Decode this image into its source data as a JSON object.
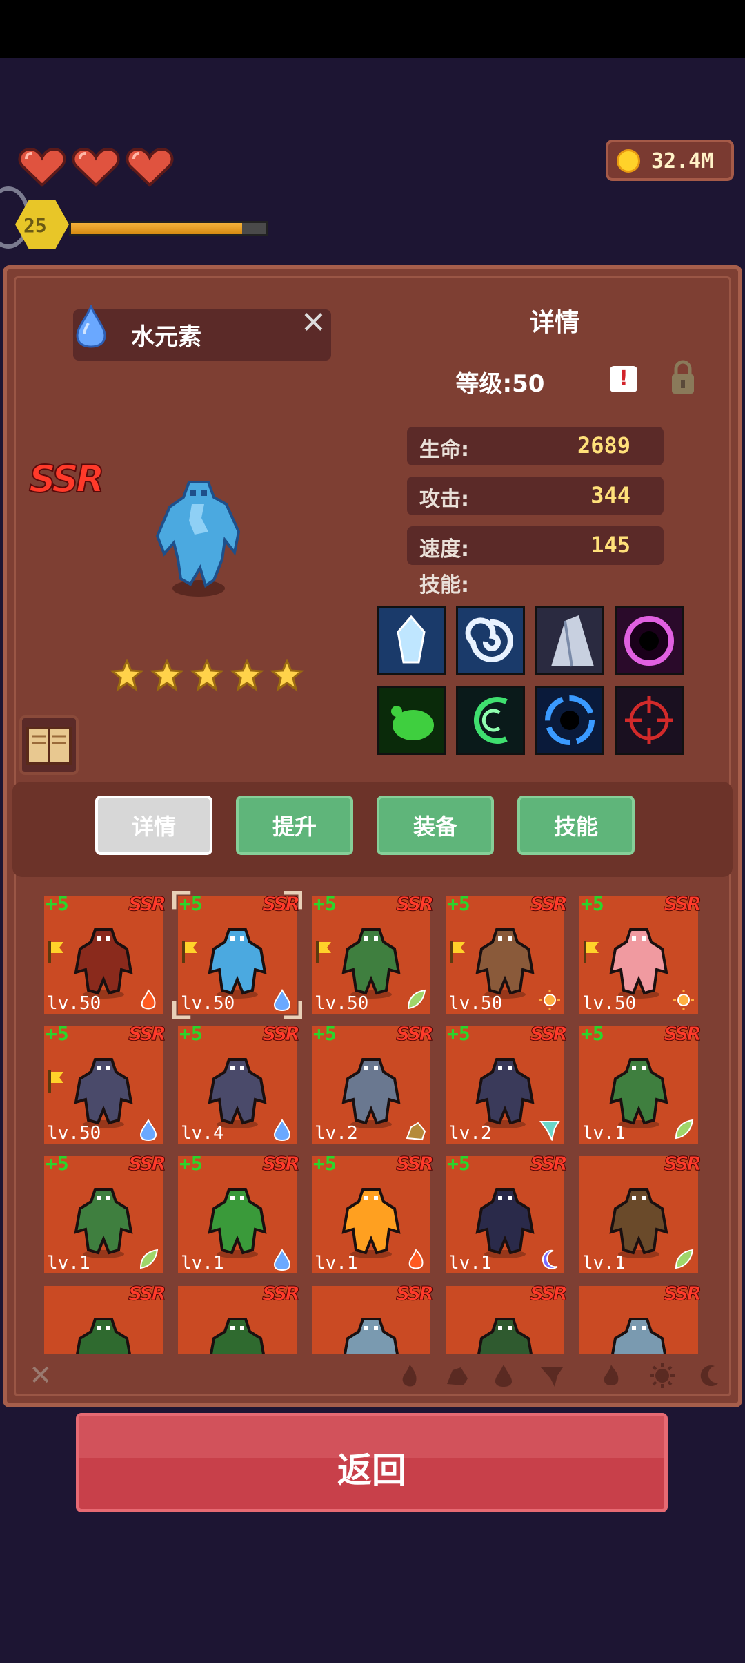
{
  "hud": {
    "hearts": 3,
    "coins": "32.4M",
    "player_level": "25",
    "xp_fraction": 0.88
  },
  "unit": {
    "name": "水元素",
    "rarity": "SSR",
    "stars": 5,
    "panel_title": "详情",
    "level_text": "等级:50",
    "alert_mark": "!"
  },
  "stats": [
    {
      "label": "生命:",
      "value": "2689"
    },
    {
      "label": "攻击:",
      "value": "344"
    },
    {
      "label": "速度:",
      "value": "145"
    }
  ],
  "skills_label": "技能:",
  "skills": [
    "ice-crystal-skill-icon",
    "whirlwind-skill-icon",
    "frost-shard-skill-icon",
    "void-orb-skill-icon",
    "poison-slime-skill-icon",
    "green-vortex-skill-icon",
    "blue-vortex-skill-icon",
    "target-reticle-skill-icon"
  ],
  "tabs": [
    {
      "label": "详情",
      "active": true
    },
    {
      "label": "提升",
      "active": false
    },
    {
      "label": "装备",
      "active": false
    },
    {
      "label": "技能",
      "active": false
    }
  ],
  "roster": [
    {
      "plus": "+5",
      "rarity": "SSR",
      "level": "lv.50",
      "flag": true,
      "creature": "fire-warlord",
      "element": "fire",
      "color": "#8a2a1c"
    },
    {
      "plus": "+5",
      "rarity": "SSR",
      "level": "lv.50",
      "flag": true,
      "creature": "water-elemental",
      "element": "water",
      "color": "#4ba9e0",
      "selected": true
    },
    {
      "plus": "+5",
      "rarity": "SSR",
      "level": "lv.50",
      "flag": true,
      "creature": "orc-knight",
      "element": "nature",
      "color": "#3f7f3f"
    },
    {
      "plus": "+5",
      "rarity": "SSR",
      "level": "lv.50",
      "flag": true,
      "creature": "centaur-spear",
      "element": "light",
      "color": "#8a5a3a"
    },
    {
      "plus": "+5",
      "rarity": "SSR",
      "level": "lv.50",
      "flag": true,
      "creature": "fairy",
      "element": "light",
      "color": "#f09aa0"
    },
    {
      "plus": "+5",
      "rarity": "SSR",
      "level": "lv.50",
      "flag": true,
      "creature": "skeleton-rider",
      "element": "water",
      "color": "#4a4a6a"
    },
    {
      "plus": "+5",
      "rarity": "SSR",
      "level": "lv.4",
      "flag": false,
      "creature": "skeleton-rider",
      "element": "water",
      "color": "#4a4a6a"
    },
    {
      "plus": "+5",
      "rarity": "SSR",
      "level": "lv.2",
      "flag": false,
      "creature": "stone-golem",
      "element": "earth",
      "color": "#6a7890"
    },
    {
      "plus": "+5",
      "rarity": "SSR",
      "level": "lv.2",
      "flag": false,
      "creature": "shadow-hound",
      "element": "wind",
      "color": "#3a3a5a"
    },
    {
      "plus": "+5",
      "rarity": "SSR",
      "level": "lv.1",
      "flag": false,
      "creature": "orc-knight",
      "element": "nature",
      "color": "#3f7f3f"
    },
    {
      "plus": "+5",
      "rarity": "SSR",
      "level": "lv.1",
      "flag": false,
      "creature": "orc-knight",
      "element": "nature",
      "color": "#3f7f3f"
    },
    {
      "plus": "+5",
      "rarity": "SSR",
      "level": "lv.1",
      "flag": false,
      "creature": "slime-golem",
      "element": "water",
      "color": "#3a9a3a"
    },
    {
      "plus": "+5",
      "rarity": "SSR",
      "level": "lv.1",
      "flag": false,
      "creature": "fire-spirit",
      "element": "fire",
      "color": "#ffa020"
    },
    {
      "plus": "+5",
      "rarity": "SSR",
      "level": "lv.1",
      "flag": false,
      "creature": "dark-knight",
      "element": "dark",
      "color": "#2a2a4a"
    },
    {
      "plus": "",
      "rarity": "SSR",
      "level": "lv.1",
      "flag": false,
      "creature": "treant",
      "element": "nature",
      "color": "#6a4a2a"
    },
    {
      "plus": "",
      "rarity": "SSR",
      "level": "",
      "flag": false,
      "creature": "forest-beast",
      "element": "",
      "color": "#2f6a2f"
    },
    {
      "plus": "",
      "rarity": "SSR",
      "level": "",
      "flag": false,
      "creature": "forest-beast",
      "element": "",
      "color": "#2f6a2f"
    },
    {
      "plus": "",
      "rarity": "SSR",
      "level": "",
      "flag": false,
      "creature": "ice-wolf",
      "element": "",
      "color": "#7a9ab0"
    },
    {
      "plus": "",
      "rarity": "SSR",
      "level": "",
      "flag": false,
      "creature": "orc-mage",
      "element": "",
      "color": "#2f5a2f"
    },
    {
      "plus": "",
      "rarity": "SSR",
      "level": "",
      "flag": false,
      "creature": "ice-wolf",
      "element": "",
      "color": "#7a9ab0"
    }
  ],
  "filters": [
    "close-filter",
    "fire-filter",
    "earth-filter",
    "water-filter",
    "wind-filter",
    "flame-filter",
    "light-filter",
    "moon-filter"
  ],
  "back_button": "返回",
  "colors": {
    "fire": "#ff5a20",
    "water": "#6aa8ff",
    "nature": "#9fd66a",
    "light": "#ffb040",
    "earth": "#b58a3a",
    "wind": "#6ad6c8",
    "dark": "#7a6aff"
  }
}
